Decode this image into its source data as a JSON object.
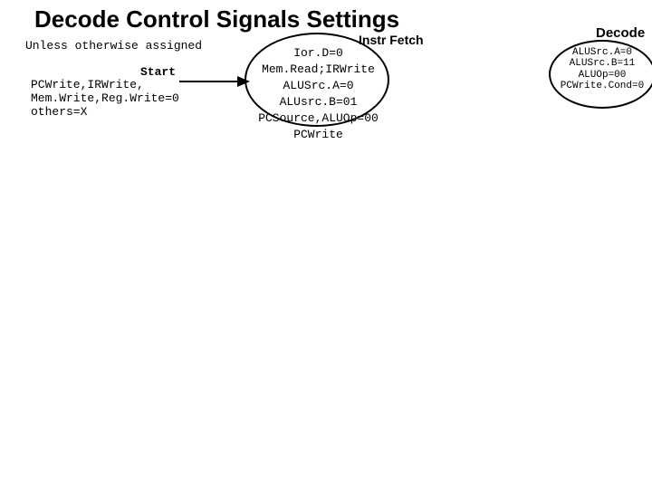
{
  "title": "Decode Control Signals Settings",
  "note": "Unless otherwise assigned",
  "start_label": "Start",
  "start_block": "PCWrite,IRWrite,\nMem.Write,Reg.Write=0\nothers=X",
  "fetch": {
    "label": "Instr Fetch",
    "text": "Ior.D=0\nMem.Read;IRWrite\nALUSrc.A=0\nALUsrc.B=01\nPCSource,ALUOp=00\nPCWrite"
  },
  "decode": {
    "label": "Decode",
    "text": "ALUSrc.A=0\nALUSrc.B=11\nALUOp=00\nPCWrite.Cond=0"
  }
}
